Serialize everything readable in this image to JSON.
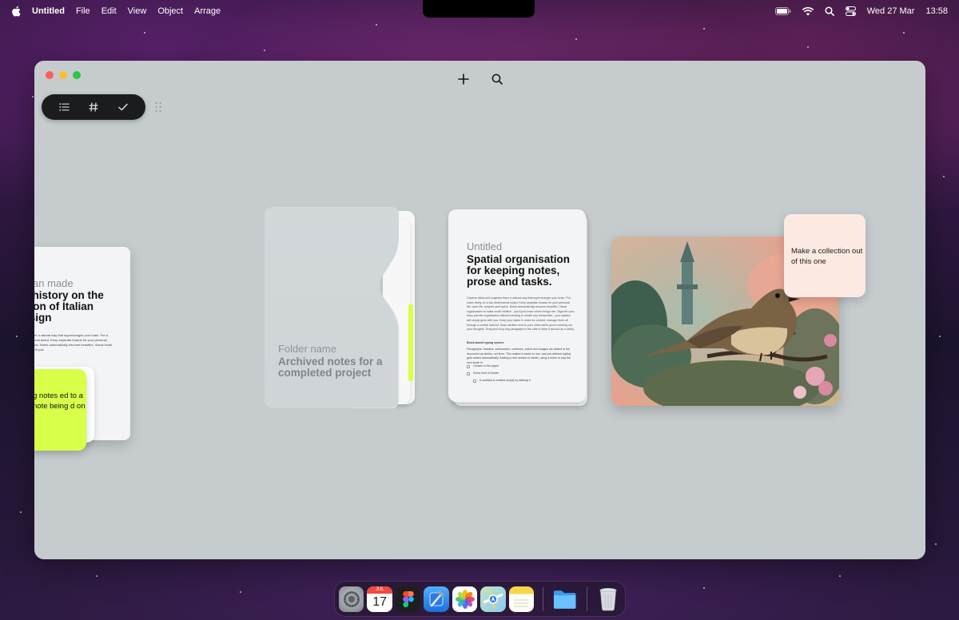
{
  "menubar": {
    "app_name": "Untitled",
    "menus": [
      "File",
      "Edit",
      "View",
      "Object",
      "Arrage"
    ],
    "date": "Wed 27 Mar",
    "time": "13:58"
  },
  "left_card": {
    "subtitle": "an made",
    "title": "ief history on the lution of Italian design",
    "body": "organise them a natural way that supercharges your brain. Put a two dimensional board. Keep separate boards for your personal ects and topics. Notes automatically become beautiful. Visual recall intuitive - you'll just"
  },
  "left_sticky": {
    "text": "g notes ed to a note being d on"
  },
  "folder": {
    "label": "Folder name",
    "title": "Archived notes for a completed project"
  },
  "doc": {
    "subtitle": "Untitled",
    "title": "Spatial organisation for keeping notes, prose and tasks.",
    "body": "Capture ideas and organise them a natural way that supercharges your brain. Put notes freely on a two dimensional board. Keep separate boards for your personal life, work life, projects and topics. Notes automatically become beautiful. Visual organisation to make recall intuitive - you'll just know where things are. Tags let's you keep precise organisation without needing to create any hierarchies - your system will simply grow with you. Keep your tasks in notes for context, manage them all through a central task list. Keep stickies next to your notes while you're working out your thoughts. Drag and drop any paragraph to the side to keep it around as a sticky.",
    "block_heading": "Block-based typing system",
    "block_body": "Paragraphs, headers, subheaders, overlines, todo's and images are added to the document as blocks, not lines. This makes it easier to use, and pre-defined styling gets added automatically. Adding a new section is easier, using a menu to pay the next block in.",
    "tasks": [
      "Chosen in the paper",
      "Some kind of binder",
      "A subtask is created simply by tabbing it"
    ]
  },
  "note_card": {
    "text": "Make a collection out of this one"
  },
  "dock": {
    "calendar_month": "JUL",
    "calendar_day": "17"
  }
}
